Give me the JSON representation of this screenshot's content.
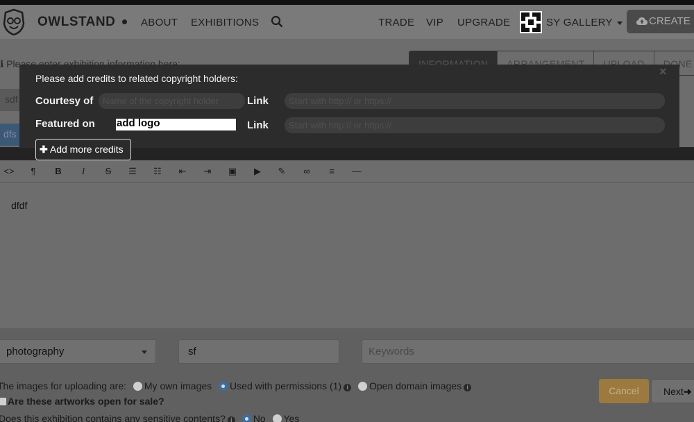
{
  "navbar": {
    "brand": "OWLSTAND",
    "links": {
      "about": "ABOUT",
      "exhibitions": "EXHIBITIONS",
      "trade": "TRADE",
      "vip": "VIP",
      "upgrade": "UPGRADE"
    },
    "gallery": "SY GALLERY",
    "create": "CREATE"
  },
  "background": {
    "info_text": "Please enter exhibition information here:",
    "tabs": [
      "INFORMATION",
      "ARRANGEMENT",
      "UPLOAD",
      "DONE"
    ],
    "field1_value": "sdf",
    "field2_value": "dfs"
  },
  "modal": {
    "title": "Please add credits to related copyright holders:",
    "close": "×",
    "courtesy_label": "Courtesy of",
    "courtesy_placeholder": "Name of the copyright holder",
    "link_label": "Link",
    "link_placeholder": "Start with http:// or https://",
    "featured_label": "Featured on",
    "featured_value": "add logo",
    "add_more": "Add more credits"
  },
  "editor": {
    "content": "dfdf"
  },
  "form": {
    "category": "photography",
    "title_value": "sf",
    "keywords_placeholder": "Keywords",
    "images_prompt": "The images for uploading are:",
    "image_options": [
      "My own images",
      "Used with permissions (1)",
      "Open domain images"
    ],
    "image_selected": "Used with permissions (1)",
    "sale_label": "Are these artworks open for sale?",
    "sensitive_prompt": "Does this exhibition contains any sensitive contents?",
    "sensitive_options": [
      "No",
      "Yes"
    ],
    "sensitive_selected": "No",
    "cancel": "Cancel",
    "next": "Next"
  },
  "colors": {
    "accent_blue": "#3a6ea5",
    "cancel_gold": "#9c7a3f",
    "modal_bg": "#2c2c2c"
  }
}
